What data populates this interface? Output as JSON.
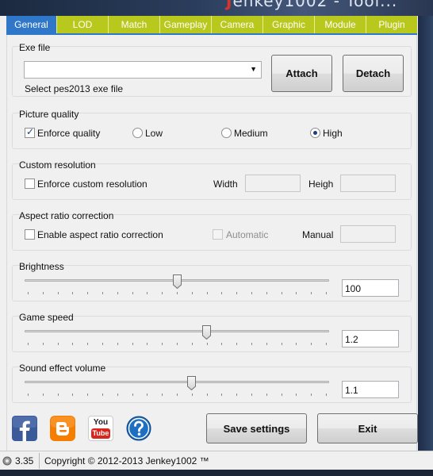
{
  "window": {
    "title_prefix": "J",
    "title_rest": "enkey1002 - Tool...",
    "accent": "#2f77c8",
    "tab_color": "#b8c81c"
  },
  "tabs": [
    {
      "label": "General",
      "active": true
    },
    {
      "label": "LOD"
    },
    {
      "label": "Match"
    },
    {
      "label": "Gameplay"
    },
    {
      "label": "Camera"
    },
    {
      "label": "Graphic"
    },
    {
      "label": "Module"
    },
    {
      "label": "Plugin"
    }
  ],
  "exe_file": {
    "title": "Exe file",
    "value": "",
    "hint": "Select pes2013 exe file",
    "attach_label": "Attach",
    "detach_label": "Detach"
  },
  "picture_quality": {
    "title": "Picture quality",
    "enforce_label": "Enforce quality",
    "enforce_checked": true,
    "options": [
      "Low",
      "Medium",
      "High"
    ],
    "selected": "High"
  },
  "custom_resolution": {
    "title": "Custom resolution",
    "enforce_label": "Enforce custom resolution",
    "enforce_checked": false,
    "width_label": "Width",
    "width_value": "",
    "height_label": "Heigh",
    "height_value": ""
  },
  "aspect_ratio": {
    "title": "Aspect ratio correction",
    "enable_label": "Enable aspect ratio correction",
    "enable_checked": false,
    "automatic_label": "Automatic",
    "manual_label": "Manual",
    "manual_value": ""
  },
  "brightness": {
    "title": "Brightness",
    "value": "100",
    "position": 0.5
  },
  "game_speed": {
    "title": "Game speed",
    "value": "1.2",
    "position": 0.6
  },
  "sound_volume": {
    "title": "Sound effect volume",
    "value": "1.1",
    "position": 0.55
  },
  "social": {
    "facebook_icon": "facebook-icon",
    "blogger_icon": "blogger-icon",
    "youtube_icon": "youtube-icon",
    "youtube_top": "You",
    "youtube_bottom": "Tube",
    "help_icon": "help-icon"
  },
  "actions": {
    "save_label": "Save settings",
    "exit_label": "Exit"
  },
  "status": {
    "version": "3.35",
    "copyright": "Copyright © 2012-2013 Jenkey1002 ™"
  }
}
